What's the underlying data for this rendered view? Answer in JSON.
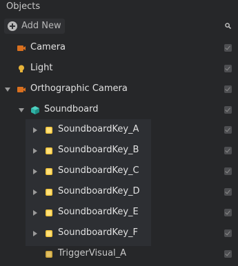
{
  "panel": {
    "title": "Objects"
  },
  "toolbar": {
    "add_new_label": "Add New",
    "search_icon": "search-icon"
  },
  "rows": [
    {
      "name": "Camera",
      "icon": "camera-icon",
      "expander": "none",
      "visible": true
    },
    {
      "name": "Light",
      "icon": "light-bulb-icon",
      "expander": "none",
      "visible": true
    },
    {
      "name": "Orthographic Camera",
      "icon": "camera-icon",
      "expander": "expanded",
      "visible": true
    },
    {
      "name": "Soundboard",
      "icon": "cube-icon",
      "expander": "expanded",
      "visible": true
    },
    {
      "name": "SoundboardKey_A",
      "icon": "object-icon",
      "expander": "collapsed",
      "visible": true
    },
    {
      "name": "SoundboardKey_B",
      "icon": "object-icon",
      "expander": "collapsed",
      "visible": true
    },
    {
      "name": "SoundboardKey_C",
      "icon": "object-icon",
      "expander": "collapsed",
      "visible": true
    },
    {
      "name": "SoundboardKey_D",
      "icon": "object-icon",
      "expander": "collapsed",
      "visible": true
    },
    {
      "name": "SoundboardKey_E",
      "icon": "object-icon",
      "expander": "collapsed",
      "visible": true
    },
    {
      "name": "SoundboardKey_F",
      "icon": "object-icon",
      "expander": "collapsed",
      "visible": true
    },
    {
      "name": "TriggerVisual_A",
      "icon": "object-icon",
      "expander": "none",
      "visible": true
    }
  ],
  "colors": {
    "background": "#262729",
    "camera_icon": "#d9701f",
    "light_icon": "#e8b43a",
    "object_icon": "#f2c53d",
    "cube_icon": "#2fb3a6"
  }
}
